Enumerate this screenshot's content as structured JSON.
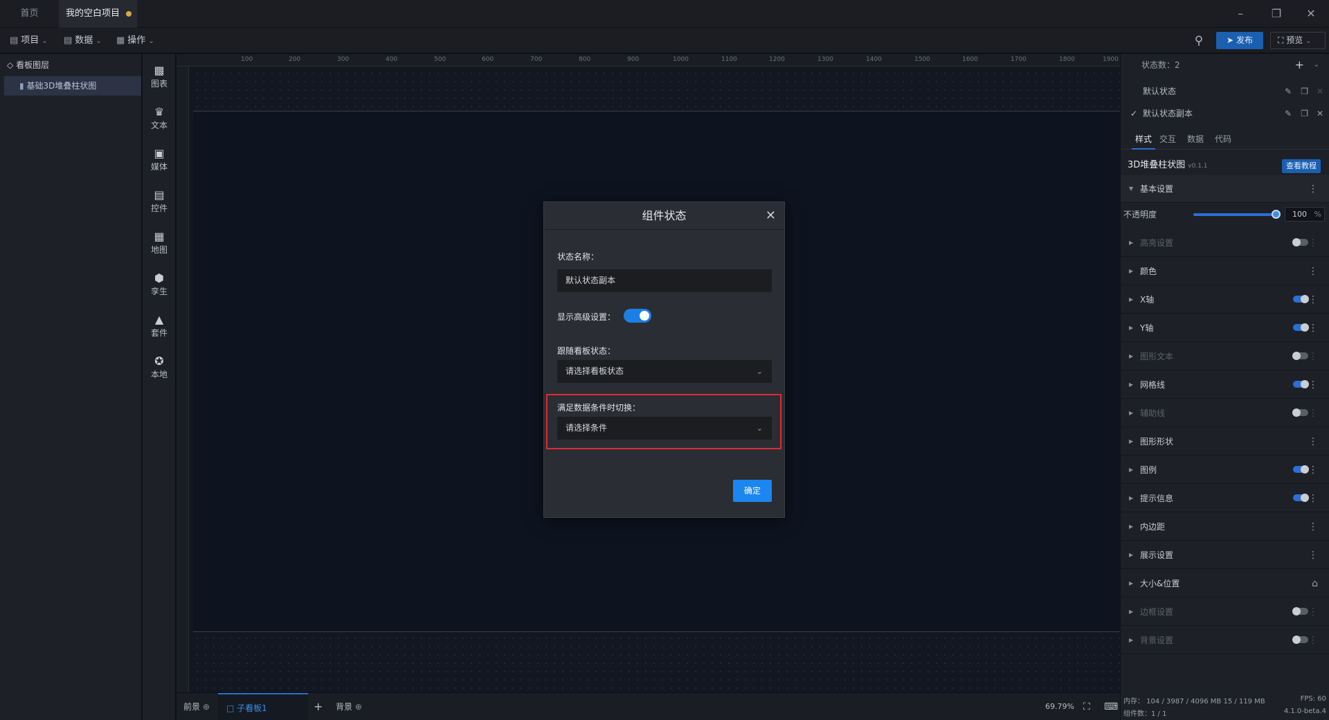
{
  "titlebar": {
    "tabs": [
      {
        "label": "首页"
      },
      {
        "label": "我的空白项目"
      }
    ]
  },
  "toolbar": {
    "menus": [
      {
        "label": "项目",
        "icon": "document-icon"
      },
      {
        "label": "数据",
        "icon": "database-icon"
      },
      {
        "label": "操作",
        "icon": "grid-icon"
      }
    ],
    "publish_label": "发布",
    "preview_label": "预览"
  },
  "layers": {
    "title": "看板图层",
    "items": [
      {
        "label": "基础3D堆叠柱状图"
      }
    ]
  },
  "components": [
    {
      "label": "图表",
      "icon": "bar-chart-icon"
    },
    {
      "label": "文本",
      "icon": "text-icon"
    },
    {
      "label": "媒体",
      "icon": "media-icon"
    },
    {
      "label": "控件",
      "icon": "control-icon"
    },
    {
      "label": "地图",
      "icon": "map-icon"
    },
    {
      "label": "孪生",
      "icon": "cube-icon"
    },
    {
      "label": "套件",
      "icon": "shirt-icon"
    },
    {
      "label": "本地",
      "icon": "puzzle-icon"
    }
  ],
  "ruler": {
    "top": [
      "100",
      "200",
      "300",
      "400",
      "500",
      "600",
      "700",
      "800",
      "900",
      "1000",
      "1100",
      "1200",
      "1300",
      "1400",
      "1500",
      "1600",
      "1700",
      "1800",
      "1900"
    ]
  },
  "bottombar": {
    "foreground": "前景",
    "subboard": "子看板1",
    "background": "背景",
    "zoom": "69.79%"
  },
  "right_panel": {
    "state_count_label": "状态数：2",
    "states": [
      {
        "label": "默认状态",
        "checked": false
      },
      {
        "label": "默认状态副本",
        "checked": true
      }
    ],
    "tabs": [
      "样式",
      "交互",
      "数据",
      "代码"
    ],
    "component_name": "3D堆叠柱状图",
    "component_version": "v0.1.1",
    "tutorial_label": "查看教程",
    "basic_settings": "基本设置",
    "opacity_label": "不透明度",
    "opacity_value": "100",
    "opacity_unit": "%",
    "opacity_level": 1.0,
    "sections": [
      {
        "label": "高亮设置",
        "disabled": true,
        "toggle": "off"
      },
      {
        "label": "颜色",
        "disabled": false,
        "toggle": "none"
      },
      {
        "label": "X轴",
        "disabled": false,
        "toggle": "on"
      },
      {
        "label": "Y轴",
        "disabled": false,
        "toggle": "on"
      },
      {
        "label": "图形文本",
        "disabled": true,
        "toggle": "off"
      },
      {
        "label": "网格线",
        "disabled": false,
        "toggle": "on"
      },
      {
        "label": "辅助线",
        "disabled": true,
        "toggle": "off"
      },
      {
        "label": "图形形状",
        "disabled": false,
        "toggle": "none"
      },
      {
        "label": "图例",
        "disabled": false,
        "toggle": "on"
      },
      {
        "label": "提示信息",
        "disabled": false,
        "toggle": "on"
      },
      {
        "label": "内边距",
        "disabled": false,
        "toggle": "none"
      },
      {
        "label": "展示设置",
        "disabled": false,
        "toggle": "none"
      },
      {
        "label": "大小&位置",
        "disabled": false,
        "toggle": "lock"
      },
      {
        "label": "边框设置",
        "disabled": true,
        "toggle": "off"
      },
      {
        "label": "背景设置",
        "disabled": true,
        "toggle": "off"
      }
    ],
    "status": {
      "memory": "内存： 104 / 3987 / 4096 MB  15 / 119 MB",
      "fps": "FPS:   60",
      "components": "组件数：1 / 1",
      "version": "4.1.0-beta.4"
    }
  },
  "modal": {
    "title": "组件状态",
    "name_label": "状态名称：",
    "name_value": "默认状态副本",
    "advanced_label": "显示高级设置：",
    "follow_label": "跟随看板状态：",
    "follow_placeholder": "请选择看板状态",
    "condition_label": "满足数据条件时切换：",
    "condition_placeholder": "请选择条件",
    "ok_label": "确定"
  }
}
